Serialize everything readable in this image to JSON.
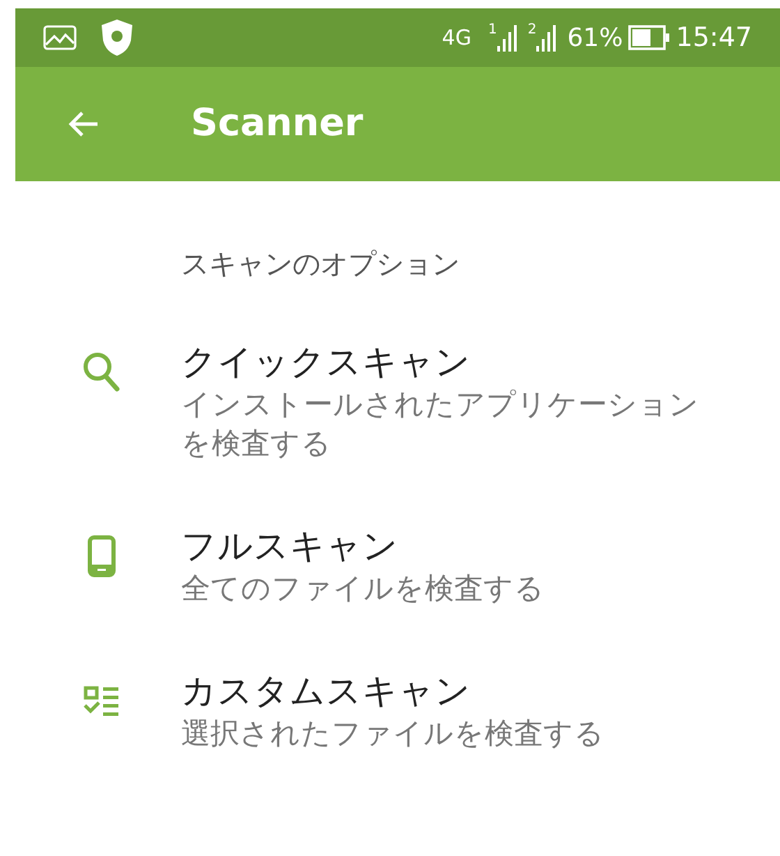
{
  "status_bar": {
    "network": "4G",
    "sim_slots": [
      "1",
      "2"
    ],
    "battery": "61%",
    "time": "15:47"
  },
  "app_bar": {
    "title": "Scanner"
  },
  "section_header": "スキャンのオプション",
  "options": [
    {
      "kind": "search",
      "title": "クイックスキャン",
      "subtitle": "インストールされたアプリケーションを検査する"
    },
    {
      "kind": "phone",
      "title": "フルスキャン",
      "subtitle": "全てのファイルを検査する"
    },
    {
      "kind": "checklist",
      "title": "カスタムスキャン",
      "subtitle": "選択されたファイルを検査する"
    }
  ]
}
